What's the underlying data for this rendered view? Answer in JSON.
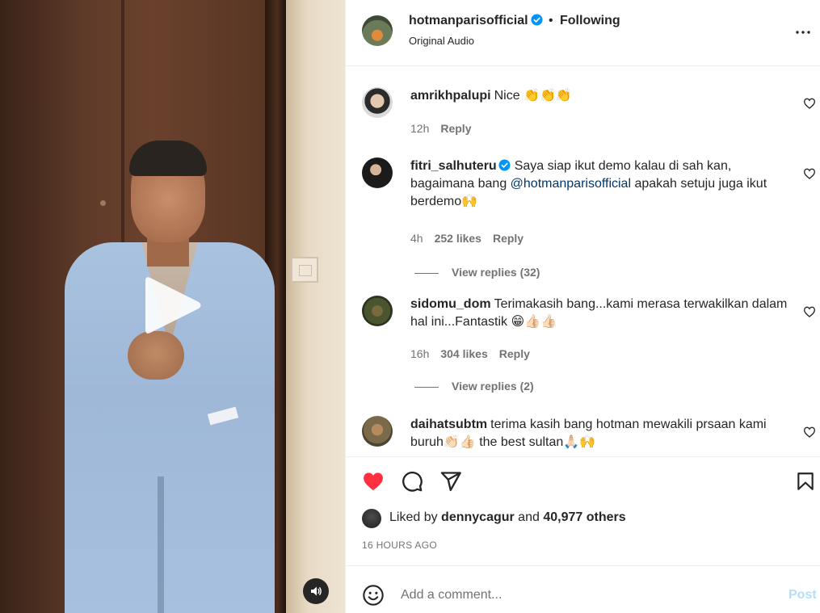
{
  "post": {
    "username": "hotmanparisofficial",
    "separator": "•",
    "follow_status": "Following",
    "audio": "Original Audio"
  },
  "comments": [
    {
      "username": "amrikhpalupi",
      "text": "Nice 👏👏👏",
      "time": "12h",
      "likes": "",
      "reply": "Reply",
      "verified": false
    },
    {
      "username": "fitri_salhuteru",
      "text_before": "Saya siap ikut demo kalau di sah kan, bagaimana bang ",
      "mention": "@hotmanparisofficial",
      "text_after": " apakah setuju juga ikut berdemo🙌",
      "time": "4h",
      "likes": "252 likes",
      "reply": "Reply",
      "verified": true,
      "view_replies": "View replies (32)"
    },
    {
      "username": "sidomu_dom",
      "text": "Terimakasih bang...kami merasa terwakilkan dalam hal ini...Fantastik 😁👍🏻👍🏻",
      "time": "16h",
      "likes": "304 likes",
      "reply": "Reply",
      "verified": false,
      "view_replies": "View replies (2)"
    },
    {
      "username": "daihatsubtm",
      "text": "terima kasih bang hotman mewakili prsaan kami buruh👏🏻👍🏻 the best sultan🙏🏻🙌",
      "verified": false
    }
  ],
  "likes": {
    "prefix": "Liked by ",
    "user": "dennycagur",
    "middle": " and ",
    "count": "40,977 others"
  },
  "timestamp": "16 HOURS AGO",
  "comment_box": {
    "placeholder": "Add a comment...",
    "post_label": "Post"
  },
  "colors": {
    "like_red": "#ff3040",
    "mention_blue": "#00376b",
    "verified_blue": "#0095f6",
    "post_disabled": "#b2dffc"
  },
  "icons": [
    "play-icon",
    "speaker-icon",
    "verified-icon",
    "more-icon",
    "heart-icon",
    "comment-icon",
    "share-icon",
    "bookmark-icon",
    "emoji-icon"
  ]
}
